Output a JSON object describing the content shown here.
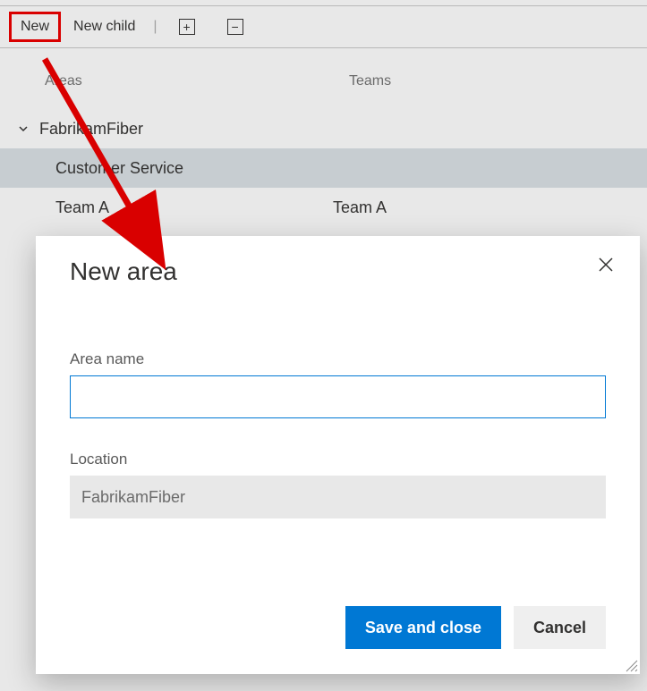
{
  "toolbar": {
    "new_label": "New",
    "new_child_label": "New child",
    "expand_icon": "+",
    "collapse_icon": "−"
  },
  "table": {
    "header_areas": "Areas",
    "header_teams": "Teams",
    "root": {
      "label": "FabrikamFiber"
    },
    "row_customer_service": {
      "label": "Customer Service",
      "team": ""
    },
    "row_team_a": {
      "label": "Team A",
      "team": "Team A"
    }
  },
  "dialog": {
    "title": "New area",
    "area_name_label": "Area name",
    "area_name_value": "",
    "location_label": "Location",
    "location_value": "FabrikamFiber",
    "save_label": "Save and close",
    "cancel_label": "Cancel"
  },
  "annotation": {
    "arrow_color": "#d90000"
  }
}
